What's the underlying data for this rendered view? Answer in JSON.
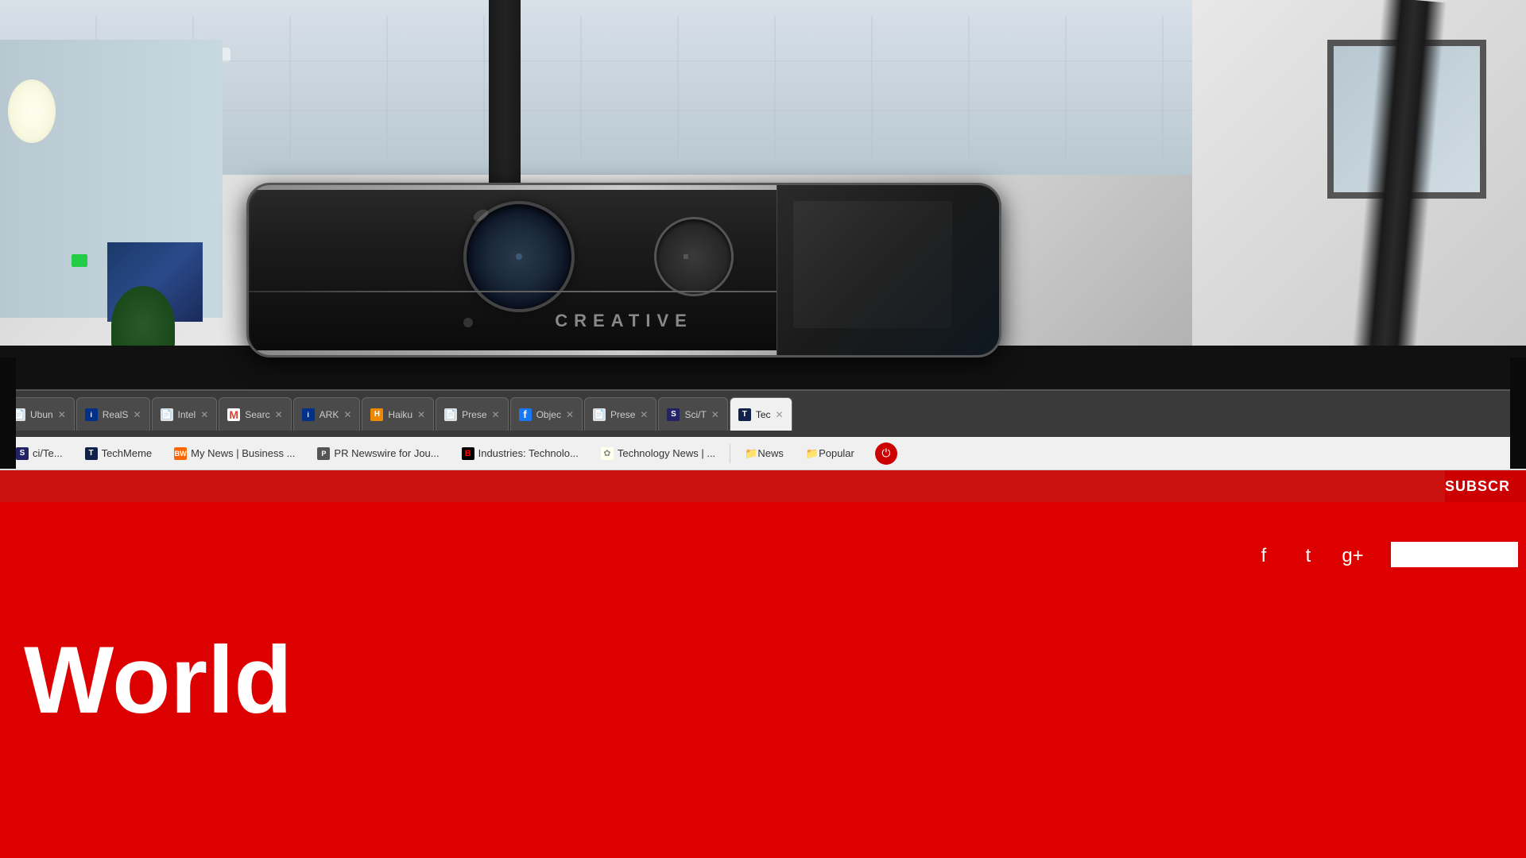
{
  "photo": {
    "alt": "Creative webcam mounted on monitor in office",
    "webcam_brand": "CREATIVE"
  },
  "browser": {
    "tabs": [
      {
        "id": "ubuntu",
        "label": "Ubun",
        "icon_type": "page",
        "icon_color": "#888",
        "active": false
      },
      {
        "id": "realse",
        "label": "RealS",
        "icon_type": "intel",
        "active": false
      },
      {
        "id": "intel1",
        "label": "Intel",
        "icon_type": "page",
        "active": false
      },
      {
        "id": "search",
        "label": "Searc",
        "icon_type": "gmail",
        "active": false
      },
      {
        "id": "ark",
        "label": "ARK",
        "icon_type": "intel",
        "active": false
      },
      {
        "id": "haiku",
        "label": "Haiku",
        "icon_type": "haiku",
        "active": false
      },
      {
        "id": "prese1",
        "label": "Prese",
        "icon_type": "page",
        "active": false
      },
      {
        "id": "objec",
        "label": "Objec",
        "icon_type": "facebook",
        "active": false
      },
      {
        "id": "prese2",
        "label": "Prese",
        "icon_type": "page",
        "active": false
      },
      {
        "id": "scite",
        "label": "Sci/T",
        "icon_type": "scite",
        "active": false
      },
      {
        "id": "techm",
        "label": "Tec",
        "icon_type": "techmeme",
        "active": true
      }
    ],
    "bookmarks": [
      {
        "id": "scite-bm",
        "label": "ci/Te...",
        "icon_type": "scite"
      },
      {
        "id": "techmeme-bm",
        "label": "TechMeme",
        "icon_type": "techmeme"
      },
      {
        "id": "mynews-bm",
        "label": "My News | Business ...",
        "icon_type": "bw"
      },
      {
        "id": "prnews-bm",
        "label": "PR Newswire for Jou...",
        "icon_type": "prnews"
      },
      {
        "id": "bloomberg-bm",
        "label": "Industries: Technolo...",
        "icon_type": "bloomberg"
      },
      {
        "id": "technews-bm",
        "label": "Technology News | ...",
        "icon_type": "leaf"
      },
      {
        "id": "news-folder",
        "label": "News",
        "icon_type": "folder"
      },
      {
        "id": "popular-folder",
        "label": "Popular",
        "icon_type": "folder"
      }
    ]
  },
  "page": {
    "subscribe_label": "SUBSCR",
    "site_name": "World",
    "social_facebook": "f",
    "social_twitter": "t",
    "social_googleplus": "g+"
  }
}
